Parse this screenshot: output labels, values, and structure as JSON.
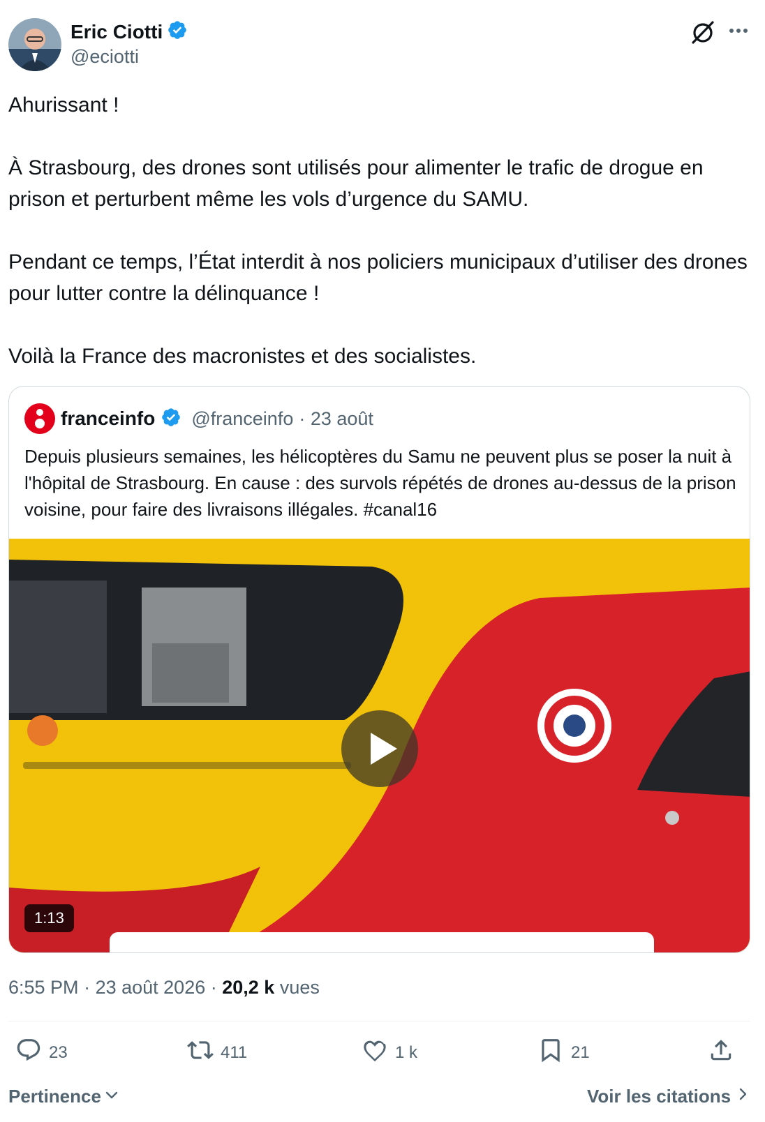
{
  "author": {
    "name": "Eric Ciotti",
    "handle": "@eciotti"
  },
  "tweet": {
    "lines": [
      "Ahurissant !",
      "À Strasbourg, des drones sont utilisés pour alimenter le trafic de drogue en prison et perturbent même les vols d’urgence du SAMU.",
      "Pendant ce temps, l’État interdit à nos policiers municipaux d’utiliser des drones pour lutter contre la délinquance !",
      "Voilà la France des macronistes et des socialistes."
    ]
  },
  "quote": {
    "name": "franceinfo",
    "handle": "@franceinfo",
    "date": "· 23 août",
    "text": "Depuis plusieurs semaines, les hélicoptères du Samu ne peuvent plus se poser la nuit à l'hôpital de Strasbourg. En cause : des survols répétés de drones au-dessus de la prison voisine, pour faire des livraisons illégales. #canal16",
    "video_duration": "1:13"
  },
  "meta": {
    "time": "6:55 PM",
    "date": "· 23 août 2026 ·",
    "views_count": "20,2 k",
    "views_label": "vues"
  },
  "actions": {
    "replies": "23",
    "reposts": "411",
    "likes": "1 k",
    "bookmarks": "21"
  },
  "footer": {
    "sort_label": "Pertinence",
    "citations_label": "Voir les citations"
  },
  "colors": {
    "verified": "#1d9bf0",
    "muted": "#536471",
    "brand_red": "#e2001a"
  }
}
